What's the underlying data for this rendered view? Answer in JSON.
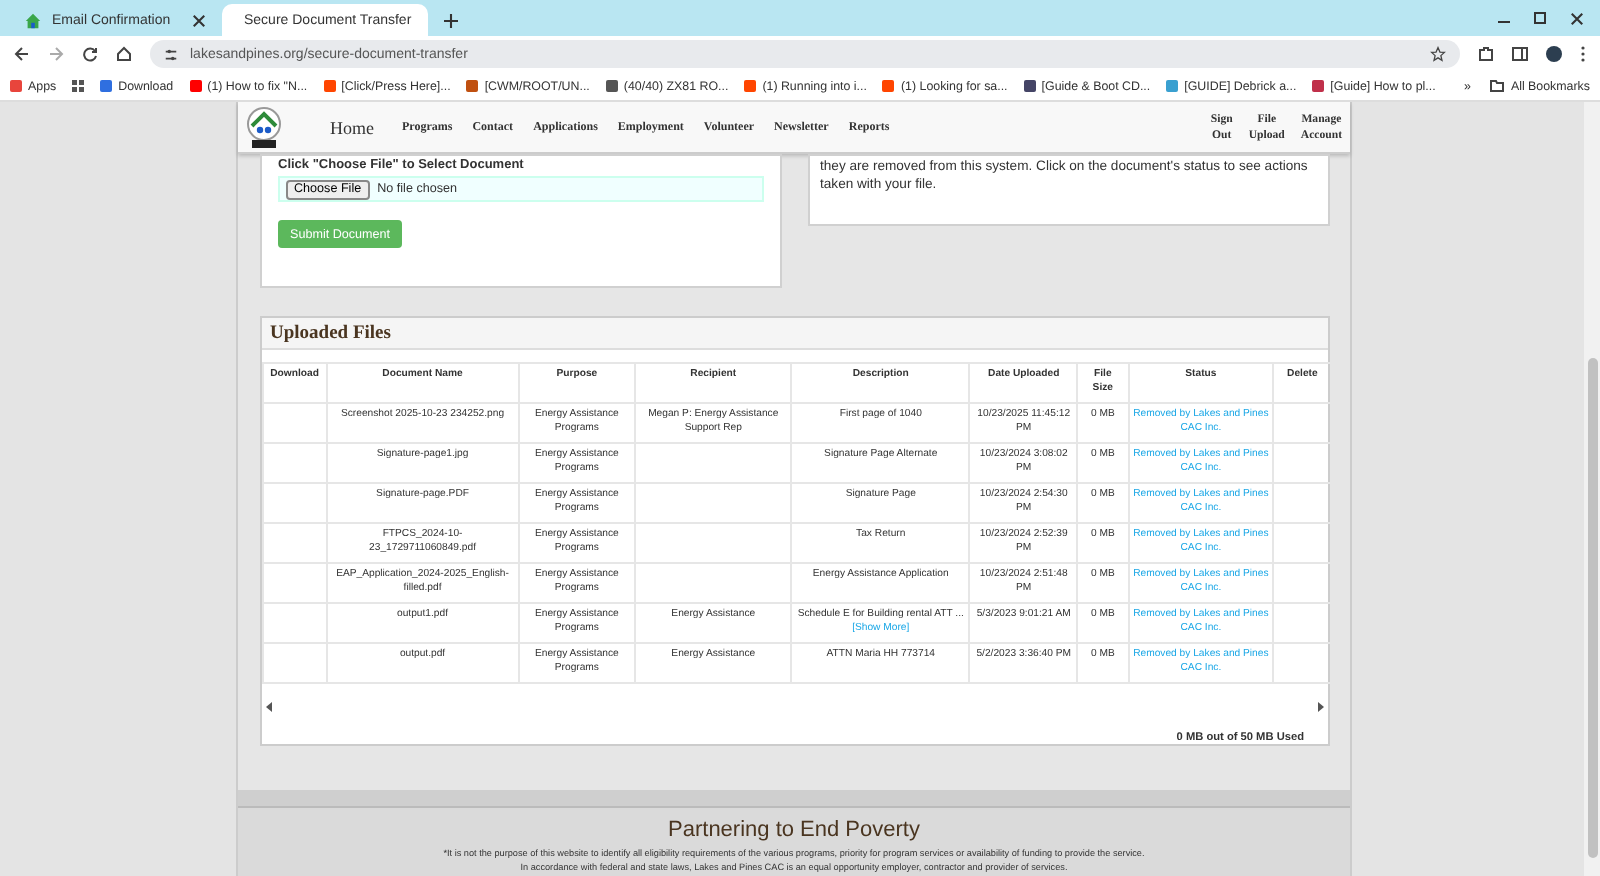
{
  "browser": {
    "tabs": [
      {
        "title": "Email Confirmation",
        "selected": false
      },
      {
        "title": "Secure Document Transfer",
        "selected": true
      }
    ],
    "address": "lakesandpines.org/secure-document-transfer",
    "bookmarks": [
      {
        "label": "Apps",
        "color": "#e8453c"
      },
      {
        "label": "Download",
        "color": "#2f6fe0"
      },
      {
        "label": "(1) How to fix \"N...",
        "color": "#ff0000"
      },
      {
        "label": "[Click/Press Here]...",
        "color": "#ff4500"
      },
      {
        "label": "[CWM/ROOT/UN...",
        "color": "#c05010"
      },
      {
        "label": "(40/40) ZX81 RO...",
        "color": "#555555"
      },
      {
        "label": "(1) Running into i...",
        "color": "#ff4500"
      },
      {
        "label": "(1) Looking for sa...",
        "color": "#ff4500"
      },
      {
        "label": "[Guide & Boot CD...",
        "color": "#444466"
      },
      {
        "label": "[GUIDE] Debrick a...",
        "color": "#3aa0d0"
      },
      {
        "label": "[Guide] How to pl...",
        "color": "#c0304a"
      }
    ],
    "more": "»",
    "all_bookmarks": "All Bookmarks"
  },
  "nav": {
    "items": [
      {
        "label": "Home",
        "kind": "home"
      },
      {
        "label": "Programs",
        "kind": "link"
      },
      {
        "label": "Contact",
        "kind": "link"
      },
      {
        "label": "Applications",
        "kind": "link"
      },
      {
        "label": "Employment",
        "kind": "link"
      },
      {
        "label": "Volunteer",
        "kind": "link"
      },
      {
        "label": "Newsletter",
        "kind": "link"
      },
      {
        "label": "Reports",
        "kind": "link"
      }
    ],
    "account": [
      "Sign Out",
      "File Upload",
      "Manage Account"
    ]
  },
  "upload": {
    "label": "Click \"Choose File\" to Select Document",
    "choose_button": "Choose File",
    "file_status": "No file chosen",
    "submit": "Submit Document"
  },
  "notice": "they are removed from this system. Click on the document's status to see actions taken with your file.",
  "files": {
    "title": "Uploaded Files",
    "columns": [
      "Download",
      "Document Name",
      "Purpose",
      "Recipient",
      "Description",
      "Date Uploaded",
      "File Size",
      "Status",
      "Delete"
    ],
    "rows": [
      {
        "document": "Screenshot 2025-10-23 234252.png",
        "purpose": "Energy Assistance Programs",
        "recipient": "Megan P: Energy Assistance Support Rep",
        "description": "First page of 1040",
        "date": "10/23/2025 11:45:12 PM",
        "size": "0 MB",
        "status": "Removed by Lakes and Pines CAC Inc."
      },
      {
        "document": "Signature-page1.jpg",
        "purpose": "Energy Assistance Programs",
        "description": "Signature Page Alternate",
        "date": "10/23/2024 3:08:02 PM",
        "size": "0 MB",
        "status": "Removed by Lakes and Pines CAC Inc."
      },
      {
        "document": "Signature-page.PDF",
        "purpose": "Energy Assistance Programs",
        "description": "Signature Page",
        "date": "10/23/2024 2:54:30 PM",
        "size": "0 MB",
        "status": "Removed by Lakes and Pines CAC Inc."
      },
      {
        "document": "FTPCS_2024-10-23_1729711060849.pdf",
        "purpose": "Energy Assistance Programs",
        "description": "Tax Return",
        "date": "10/23/2024 2:52:39 PM",
        "size": "0 MB",
        "status": "Removed by Lakes and Pines CAC Inc."
      },
      {
        "document": "EAP_Application_2024-2025_English-filled.pdf",
        "purpose": "Energy Assistance Programs",
        "description": "Energy Assistance Application",
        "date": "10/23/2024 2:51:48 PM",
        "size": "0 MB",
        "status": "Removed by Lakes and Pines CAC Inc."
      },
      {
        "document": "output1.pdf",
        "purpose": "Energy Assistance Programs",
        "recipient": "Energy Assistance",
        "description": "Schedule E for Building rental ATT ...",
        "show_more": "[Show More]",
        "date": "5/3/2023 9:01:21 AM",
        "size": "0 MB",
        "status": "Removed by Lakes and Pines CAC Inc."
      },
      {
        "document": "output.pdf",
        "purpose": "Energy Assistance Programs",
        "recipient": "Energy Assistance",
        "description": "ATTN Maria HH 773714",
        "date": "5/2/2023 3:36:40 PM",
        "size": "0 MB",
        "status": "Removed by Lakes and Pines CAC Inc."
      }
    ],
    "usage": "0 MB out of 50 MB Used"
  },
  "footer": {
    "title": "Partnering to End Poverty",
    "lines": [
      "*It is not the purpose of this website to identify all eligibility requirements of the various programs, priority for program services or availability of funding to provide the service.",
      "In accordance with federal and state laws, Lakes and Pines CAC is an equal opportunity employer, contractor and provider of services."
    ]
  }
}
